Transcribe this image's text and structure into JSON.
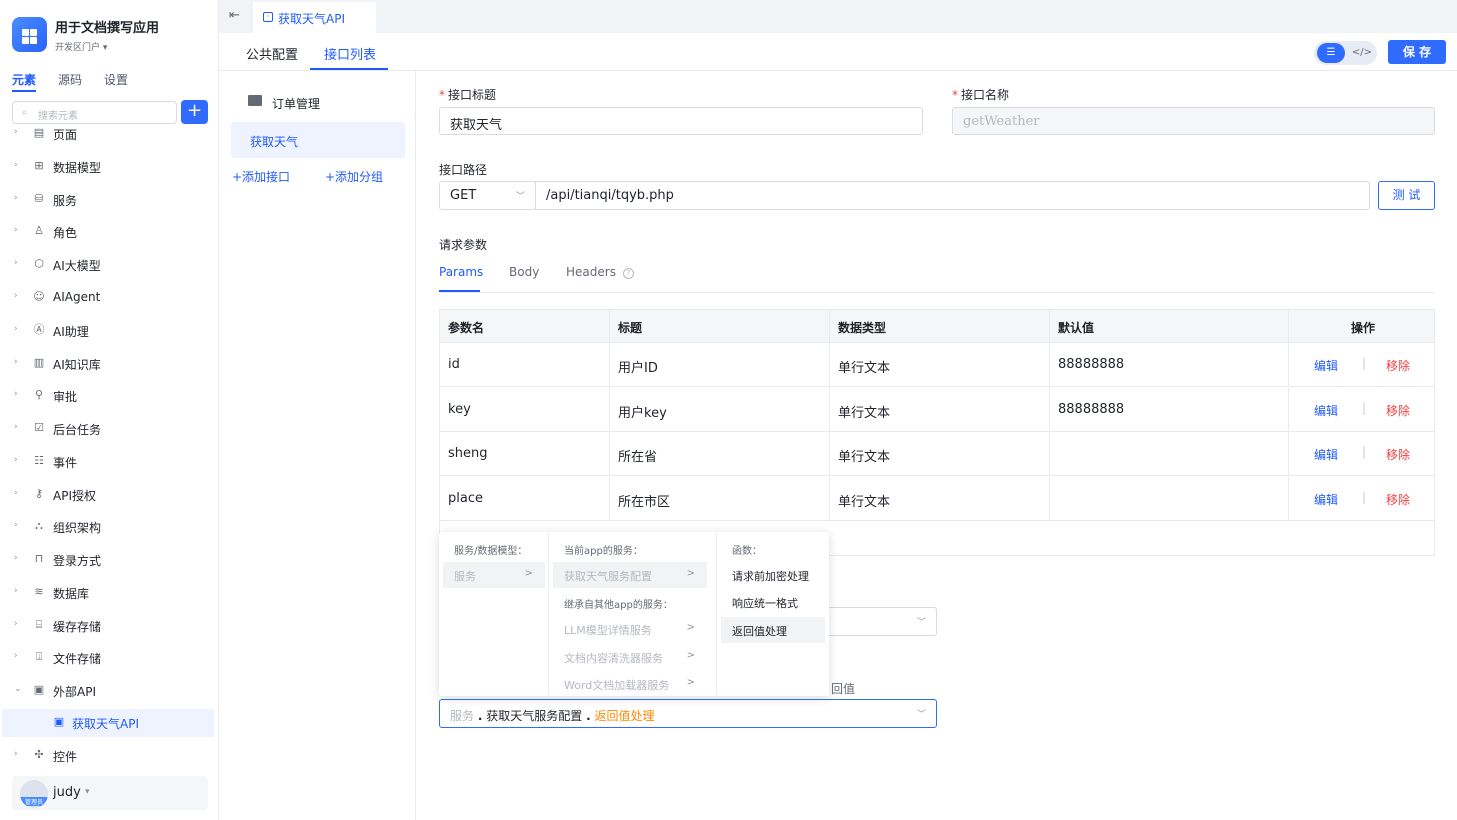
{
  "app": {
    "name": "用于文档撰写应用",
    "portal": "开发区门户 ▾"
  },
  "sidebar": {
    "tabs": [
      "元素",
      "源码",
      "设置"
    ],
    "search_placeholder": "搜索元素",
    "add_label": "+",
    "items": [
      {
        "label": "页面",
        "icon": "page-icon"
      },
      {
        "label": "数据模型",
        "icon": "table-icon"
      },
      {
        "label": "服务",
        "icon": "service-icon"
      },
      {
        "label": "角色",
        "icon": "role-icon"
      },
      {
        "label": "AI大模型",
        "icon": "ai-model-icon"
      },
      {
        "label": "AIAgent",
        "icon": "robot-icon"
      },
      {
        "label": "AI助理",
        "icon": "ai-assistant-icon"
      },
      {
        "label": "AI知识库",
        "icon": "book-icon"
      },
      {
        "label": "审批",
        "icon": "stamp-icon"
      },
      {
        "label": "后台任务",
        "icon": "task-icon"
      },
      {
        "label": "事件",
        "icon": "event-icon"
      },
      {
        "label": "API授权",
        "icon": "key-icon"
      },
      {
        "label": "组织架构",
        "icon": "org-icon"
      },
      {
        "label": "登录方式",
        "icon": "login-icon"
      },
      {
        "label": "数据库",
        "icon": "database-icon"
      },
      {
        "label": "缓存存储",
        "icon": "cache-icon"
      },
      {
        "label": "文件存储",
        "icon": "file-storage-icon"
      },
      {
        "label": "外部API",
        "icon": "api-icon"
      }
    ],
    "child_item": {
      "label": "获取天气API",
      "icon": "api-icon"
    },
    "last_item": {
      "label": "控件",
      "icon": "puzzle-icon"
    },
    "user": {
      "name": "judy",
      "role_tag": "管理员"
    }
  },
  "topbar": {
    "tab_label": "获取天气API"
  },
  "subtabs": [
    "公共配置",
    "接口列表"
  ],
  "toolbar": {
    "save_label": "保 存",
    "toggle_on": "☰",
    "toggle_off": "</>"
  },
  "api_list": {
    "folder": "订单管理",
    "selected": "获取天气",
    "add_api": "+添加接口",
    "add_group": "+添加分组"
  },
  "form": {
    "title_label": "接口标题",
    "title_value": "获取天气",
    "name_label": "接口名称",
    "name_value": "getWeather",
    "path_label": "接口路径",
    "method": "GET",
    "path_value": "/api/tianqi/tqyb.php",
    "test_label": "测 试",
    "params_label": "请求参数",
    "param_tabs": [
      "Params",
      "Body",
      "Headers"
    ]
  },
  "table": {
    "headers": [
      "参数名",
      "标题",
      "数据类型",
      "默认值",
      "操作"
    ],
    "rows": [
      {
        "name": "id",
        "title": "用户ID",
        "type": "单行文本",
        "default": "88888888"
      },
      {
        "name": "key",
        "title": "用户key",
        "type": "单行文本",
        "default": "88888888"
      },
      {
        "name": "sheng",
        "title": "所在省",
        "type": "单行文本",
        "default": ""
      },
      {
        "name": "place",
        "title": "所在市区",
        "type": "单行文本",
        "default": ""
      }
    ],
    "edit_label": "编辑",
    "sep": "|",
    "remove_label": "移除"
  },
  "cascader": {
    "col1_group": "服务/数据模型：",
    "col1_options": [
      "服务"
    ],
    "col2_group1": "当前app的服务：",
    "col2_group1_options": [
      "获取天气服务配置"
    ],
    "col2_group2": "继承自其他app的服务：",
    "col2_group2_options": [
      "LLM模型详情服务",
      "文档内容清洗器服务",
      "Word文档加载器服务"
    ],
    "col3_group": "函数：",
    "col3_options": [
      "请求前加密处理",
      "响应统一格式",
      "返回值处理"
    ]
  },
  "fn_select": {
    "part1": "服务",
    "dot1": ".",
    "part2": "获取天气服务配置",
    "dot2": ".",
    "part3": "返回值处理",
    "frag_label": "回值"
  },
  "colors": {
    "primary": "#2f6bff",
    "danger": "#f53f3f",
    "highlight": "#ff8800"
  }
}
